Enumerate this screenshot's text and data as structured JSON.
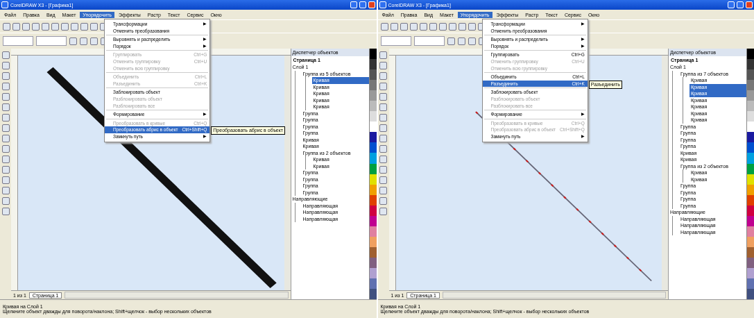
{
  "windows": [
    {
      "title": "CorelDRAW X3 - [Графика1]",
      "menubar": [
        {
          "label": "Файл",
          "selected": false
        },
        {
          "label": "Правка",
          "selected": false
        },
        {
          "label": "Вид",
          "selected": false
        },
        {
          "label": "Макет",
          "selected": false
        },
        {
          "label": "Упорядочить",
          "selected": true
        },
        {
          "label": "Эффекты",
          "selected": false
        },
        {
          "label": "Растр",
          "selected": false
        },
        {
          "label": "Текст",
          "selected": false
        },
        {
          "label": "Сервис",
          "selected": false
        },
        {
          "label": "Окно",
          "selected": false
        }
      ],
      "menu": [
        {
          "kind": "item",
          "label": "Трансформации",
          "disabled": false,
          "selected": false,
          "arrow": "▶"
        },
        {
          "kind": "item",
          "label": "Отменить преобразования",
          "disabled": false,
          "selected": false
        },
        {
          "kind": "separator"
        },
        {
          "kind": "item",
          "label": "Выровнять и распределить",
          "disabled": false,
          "selected": false,
          "arrow": "▶"
        },
        {
          "kind": "item",
          "label": "Порядок",
          "disabled": false,
          "selected": false,
          "arrow": "▶"
        },
        {
          "kind": "separator"
        },
        {
          "kind": "item",
          "label": "Группировать",
          "shortcut": "Ctrl+G",
          "disabled": true,
          "selected": false
        },
        {
          "kind": "item",
          "label": "Отменить группировку",
          "shortcut": "Ctrl+U",
          "disabled": true,
          "selected": false
        },
        {
          "kind": "item",
          "label": "Отменить всю группировку",
          "disabled": true,
          "selected": false
        },
        {
          "kind": "separator"
        },
        {
          "kind": "item",
          "label": "Объединить",
          "shortcut": "Ctrl+L",
          "disabled": true,
          "selected": false
        },
        {
          "kind": "item",
          "label": "Разъединить",
          "shortcut": "Ctrl+K",
          "disabled": true,
          "selected": false
        },
        {
          "kind": "separator"
        },
        {
          "kind": "item",
          "label": "Заблокировать объект",
          "disabled": false,
          "selected": false
        },
        {
          "kind": "item",
          "label": "Разблокировать объект",
          "disabled": true,
          "selected": false
        },
        {
          "kind": "item",
          "label": "Разблокировать все",
          "disabled": true,
          "selected": false
        },
        {
          "kind": "separator"
        },
        {
          "kind": "item",
          "label": "Формирование",
          "disabled": false,
          "selected": false,
          "arrow": "▶"
        },
        {
          "kind": "separator"
        },
        {
          "kind": "item",
          "label": "Преобразовать в кривые",
          "shortcut": "Ctrl+Q",
          "disabled": true,
          "selected": false
        },
        {
          "kind": "item",
          "label": "Преобразовать абрис в объект",
          "shortcut": "Ctrl+Shift+Q",
          "disabled": false,
          "selected": true
        },
        {
          "kind": "item",
          "label": "Замкнуть путь",
          "disabled": false,
          "selected": false,
          "arrow": "▶"
        }
      ],
      "tooltip": "Преобразовать абрис в объект",
      "docker": {
        "title": "Диспетчер объектов",
        "page": "Страница 1",
        "tree": [
          {
            "label": "Слой 1",
            "selected": false,
            "children": [
              {
                "label": "Группа из 5 объектов",
                "selected": false,
                "children": [
                  {
                    "label": "Кривая",
                    "selected": true
                  },
                  {
                    "label": "Кривая",
                    "selected": false
                  },
                  {
                    "label": "Кривая",
                    "selected": false
                  },
                  {
                    "label": "Кривая",
                    "selected": false
                  },
                  {
                    "label": "Кривая",
                    "selected": false
                  }
                ]
              },
              {
                "label": "Группа",
                "selected": false
              },
              {
                "label": "Группа",
                "selected": false
              },
              {
                "label": "Группа",
                "selected": false
              },
              {
                "label": "Группа",
                "selected": false
              },
              {
                "label": "Кривая",
                "selected": false
              },
              {
                "label": "Кривая",
                "selected": false
              },
              {
                "label": "Группа из 2 объектов",
                "selected": false,
                "children": [
                  {
                    "label": "Кривая",
                    "selected": false
                  },
                  {
                    "label": "Кривая",
                    "selected": false
                  }
                ]
              },
              {
                "label": "Группа",
                "selected": false
              },
              {
                "label": "Группа",
                "selected": false
              },
              {
                "label": "Группа",
                "selected": false
              },
              {
                "label": "Группа",
                "selected": false
              }
            ]
          },
          {
            "label": "Направляющие",
            "selected": false,
            "children": [
              {
                "label": "Направляющая",
                "selected": false
              },
              {
                "label": "Направляющая",
                "selected": false
              },
              {
                "label": "Направляющая",
                "selected": false
              }
            ]
          }
        ]
      },
      "page_counter": "1 из 1",
      "page_tab": "Страница 1",
      "status": [
        "Кривая на Слой 1",
        "Щелкните объект дважды для поворота/наклона; Shift+щелчок - выбор нескольких объектов"
      ]
    },
    {
      "title": "CorelDRAW X3 - [Графика1]",
      "menubar": [
        {
          "label": "Файл",
          "selected": false
        },
        {
          "label": "Правка",
          "selected": false
        },
        {
          "label": "Вид",
          "selected": false
        },
        {
          "label": "Макет",
          "selected": false
        },
        {
          "label": "Упорядочить",
          "selected": true
        },
        {
          "label": "Эффекты",
          "selected": false
        },
        {
          "label": "Растр",
          "selected": false
        },
        {
          "label": "Текст",
          "selected": false
        },
        {
          "label": "Сервис",
          "selected": false
        },
        {
          "label": "Окно",
          "selected": false
        }
      ],
      "menu": [
        {
          "kind": "item",
          "label": "Трансформации",
          "disabled": false,
          "selected": false,
          "arrow": "▶"
        },
        {
          "kind": "item",
          "label": "Отменить преобразования",
          "disabled": false,
          "selected": false
        },
        {
          "kind": "separator"
        },
        {
          "kind": "item",
          "label": "Выровнять и распределить",
          "disabled": false,
          "selected": false,
          "arrow": "▶"
        },
        {
          "kind": "item",
          "label": "Порядок",
          "disabled": false,
          "selected": false,
          "arrow": "▶"
        },
        {
          "kind": "separator"
        },
        {
          "kind": "item",
          "label": "Группировать",
          "shortcut": "Ctrl+G",
          "disabled": false,
          "selected": false
        },
        {
          "kind": "item",
          "label": "Отменить группировку",
          "shortcut": "Ctrl+U",
          "disabled": true,
          "selected": false
        },
        {
          "kind": "item",
          "label": "Отменить всю группировку",
          "disabled": true,
          "selected": false
        },
        {
          "kind": "separator"
        },
        {
          "kind": "item",
          "label": "Объединить",
          "shortcut": "Ctrl+L",
          "disabled": false,
          "selected": false
        },
        {
          "kind": "item",
          "label": "Разъединить",
          "shortcut": "Ctrl+K",
          "disabled": false,
          "selected": true
        },
        {
          "kind": "separator"
        },
        {
          "kind": "item",
          "label": "Заблокировать объект",
          "disabled": false,
          "selected": false
        },
        {
          "kind": "item",
          "label": "Разблокировать объект",
          "disabled": true,
          "selected": false
        },
        {
          "kind": "item",
          "label": "Разблокировать все",
          "disabled": true,
          "selected": false
        },
        {
          "kind": "separator"
        },
        {
          "kind": "item",
          "label": "Формирование",
          "disabled": false,
          "selected": false,
          "arrow": "▶"
        },
        {
          "kind": "separator"
        },
        {
          "kind": "item",
          "label": "Преобразовать в кривые",
          "shortcut": "Ctrl+Q",
          "disabled": true,
          "selected": false
        },
        {
          "kind": "item",
          "label": "Преобразовать абрис в объект",
          "shortcut": "Ctrl+Shift+Q",
          "disabled": true,
          "selected": false
        },
        {
          "kind": "item",
          "label": "Замкнуть путь",
          "disabled": false,
          "selected": false,
          "arrow": "▶"
        }
      ],
      "tooltip": "Разъединить",
      "docker": {
        "title": "Диспетчер объектов",
        "page": "Страница 1",
        "tree": [
          {
            "label": "Слой 1",
            "selected": false,
            "children": [
              {
                "label": "Группа из 7 объектов",
                "selected": false,
                "children": [
                  {
                    "label": "Кривая",
                    "selected": false
                  },
                  {
                    "label": "Кривая",
                    "selected": true
                  },
                  {
                    "label": "Кривая",
                    "selected": true
                  },
                  {
                    "label": "Кривая",
                    "selected": false
                  },
                  {
                    "label": "Кривая",
                    "selected": false
                  },
                  {
                    "label": "Кривая",
                    "selected": false
                  },
                  {
                    "label": "Кривая",
                    "selected": false
                  }
                ]
              },
              {
                "label": "Группа",
                "selected": false
              },
              {
                "label": "Группа",
                "selected": false
              },
              {
                "label": "Группа",
                "selected": false
              },
              {
                "label": "Группа",
                "selected": false
              },
              {
                "label": "Кривая",
                "selected": false
              },
              {
                "label": "Кривая",
                "selected": false
              },
              {
                "label": "Группа из 2 объектов",
                "selected": false,
                "children": [
                  {
                    "label": "Кривая",
                    "selected": false
                  },
                  {
                    "label": "Кривая",
                    "selected": false
                  }
                ]
              },
              {
                "label": "Группа",
                "selected": false
              },
              {
                "label": "Группа",
                "selected": false
              },
              {
                "label": "Группа",
                "selected": false
              },
              {
                "label": "Группа",
                "selected": false
              }
            ]
          },
          {
            "label": "Направляющие",
            "selected": false,
            "children": [
              {
                "label": "Направляющая",
                "selected": false
              },
              {
                "label": "Направляющая",
                "selected": false
              },
              {
                "label": "Направляющая",
                "selected": false
              }
            ]
          }
        ]
      },
      "page_counter": "1 из 1",
      "page_tab": "Страница 1",
      "status": [
        "Кривая на Слой 1",
        "Щелкните объект дважды для поворота/наклона; Shift+щелчок - выбор нескольких объектов"
      ]
    }
  ]
}
